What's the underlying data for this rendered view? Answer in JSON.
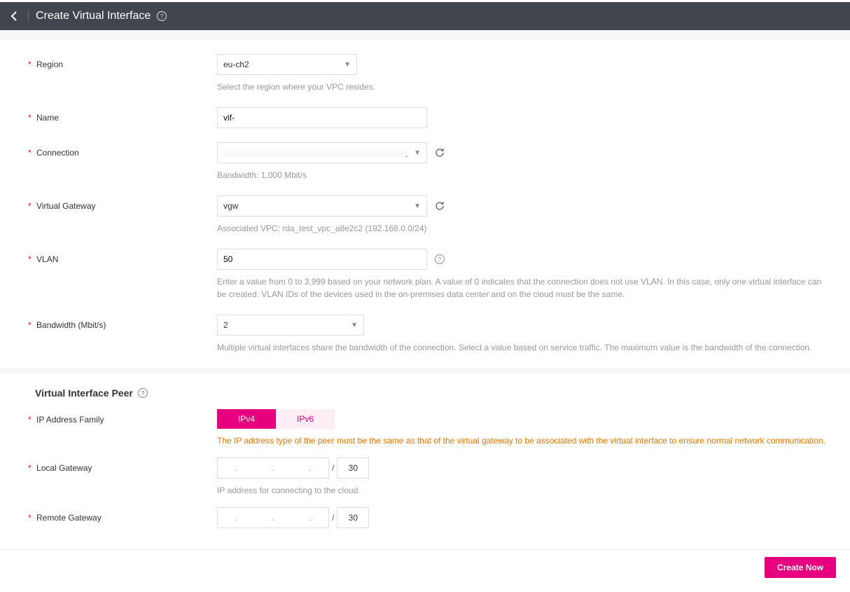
{
  "header": {
    "title": "Create Virtual Interface"
  },
  "form": {
    "region": {
      "label": "Region",
      "value": "eu-ch2",
      "helper": "Select the region where your VPC resides."
    },
    "name": {
      "label": "Name",
      "value": "vif-"
    },
    "connection": {
      "label": "Connection",
      "value": "",
      "bandwidth_info": "Bandwidth: 1,000 Mbit/s"
    },
    "virtual_gateway": {
      "label": "Virtual Gateway",
      "value": "vgw",
      "associated_vpc": "Associated VPC: rda_test_vpc_a8e2c2 (192.168.0.0/24)"
    },
    "vlan": {
      "label": "VLAN",
      "value": "50",
      "helper": "Enter a value from 0 to 3,999 based on your network plan. A value of 0 indicates that the connection does not use VLAN. In this case, only one virtual interface can be created. VLAN IDs of the devices used in the on-premises data center and on the cloud must be the same."
    },
    "bandwidth": {
      "label": "Bandwidth (Mbit/s)",
      "value": "2",
      "helper": "Multiple virtual interfaces share the bandwidth of the connection. Select a value based on service traffic. The maximum value is the bandwidth of the connection."
    }
  },
  "peer": {
    "title": "Virtual Interface Peer",
    "ip_family": {
      "label": "IP Address Family",
      "options": {
        "ipv4": "IPv4",
        "ipv6": "IPv6"
      },
      "selected": "ipv4",
      "warning": "The IP address type of the peer must be the same as that of the virtual gateway to be associated with the virtual interface to ensure normal network communication."
    },
    "local_gateway": {
      "label": "Local Gateway",
      "cidr": "30",
      "helper": "IP address for connecting to the cloud."
    },
    "remote_gateway": {
      "label": "Remote Gateway",
      "cidr": "30"
    }
  },
  "footer": {
    "create_label": "Create Now"
  }
}
